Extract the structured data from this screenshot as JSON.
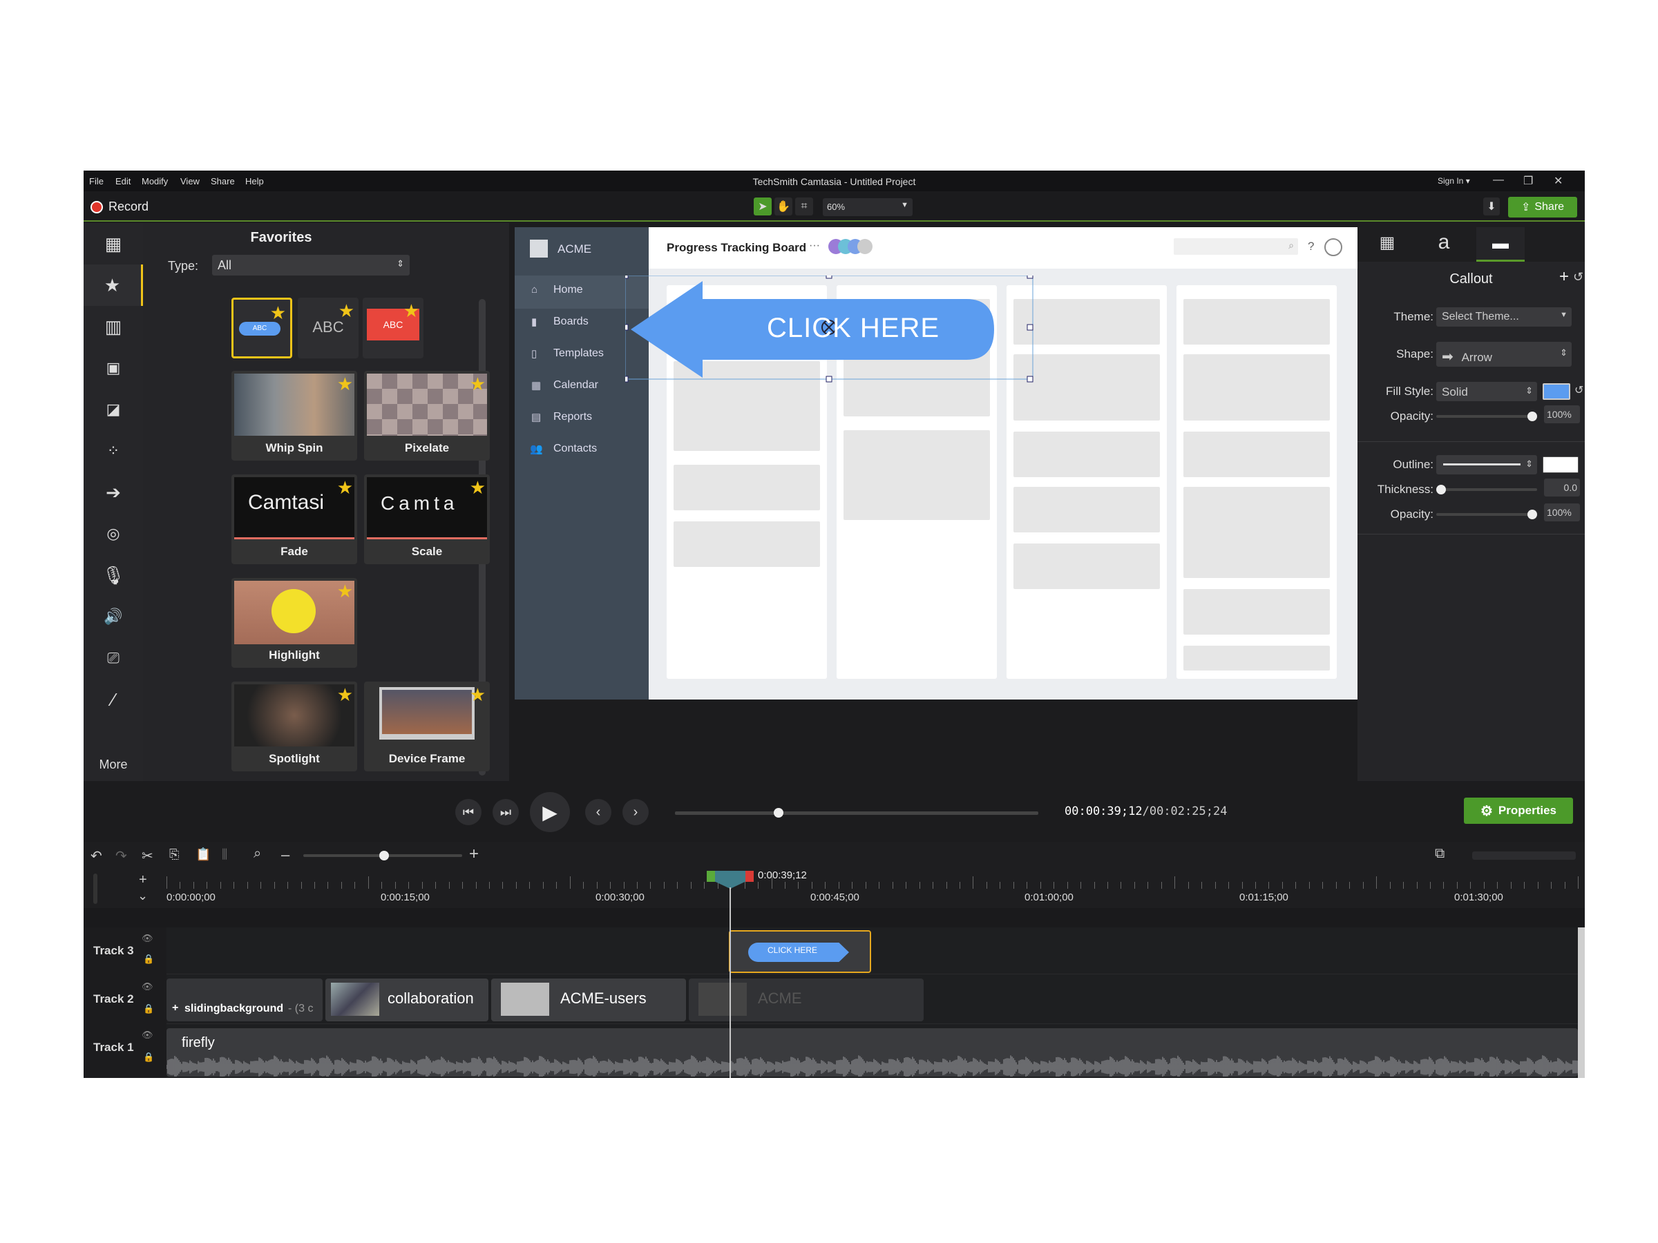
{
  "window": {
    "title": "TechSmith Camtasia - Untitled Project",
    "menu": [
      "File",
      "Edit",
      "Modify",
      "View",
      "Share",
      "Help"
    ],
    "sign_in": "Sign In ▾"
  },
  "toolbar": {
    "record_label": "Record",
    "zoom": "60%",
    "share_label": "Share"
  },
  "library": {
    "title": "Favorites",
    "type_label": "Type:",
    "type_value": "All",
    "more_label": "More",
    "callouts": [
      "ABC",
      "ABC",
      "ABC"
    ],
    "items": [
      {
        "label": "Whip Spin"
      },
      {
        "label": "Pixelate"
      },
      {
        "label": "Fade",
        "thumb_text": "Camtasi"
      },
      {
        "label": "Scale",
        "thumb_text": "Camta"
      },
      {
        "label": "Highlight"
      },
      {
        "label": "Spotlight"
      },
      {
        "label": "Device Frame"
      }
    ]
  },
  "canvas": {
    "app_name": "ACME",
    "board_title": "Progress Tracking Board",
    "board_more": "···",
    "nav": [
      "Home",
      "Boards",
      "Templates",
      "Calendar",
      "Reports",
      "Contacts"
    ],
    "callout_text": "CLICK HERE",
    "help": "?"
  },
  "properties": {
    "title": "Callout",
    "theme_label": "Theme:",
    "theme_value": "Select Theme...",
    "shape_label": "Shape:",
    "shape_value": "Arrow",
    "fill_label": "Fill Style:",
    "fill_value": "Solid",
    "opacity_label": "Opacity:",
    "opacity_value": "100%",
    "outline_label": "Outline:",
    "thickness_label": "Thickness:",
    "thickness_value": "0.0",
    "opacity2_label": "Opacity:",
    "opacity2_value": "100%",
    "button": "Properties",
    "fill_color": "#5b9cf0",
    "outline_color": "#ffffff",
    "opacity_level": 1.0,
    "opacity2_level": 1.0,
    "thickness_level": 0.0
  },
  "playback": {
    "time_current": "00:00:39;12",
    "time_total": "00:02:25;24",
    "separator": "/",
    "progress": 0.28
  },
  "timeline": {
    "playhead_time": "0:00:39;12",
    "ruler": [
      "0:00:00;00",
      "0:00:15;00",
      "0:00:30;00",
      "0:00:45;00",
      "0:01:00;00",
      "0:01:15;00",
      "0:01:30;00"
    ],
    "tracks": [
      {
        "label": "Track 3"
      },
      {
        "label": "Track 2"
      },
      {
        "label": "Track 1"
      }
    ],
    "clips": {
      "callout": "CLICK HERE",
      "group": "slidingbackground",
      "group_suffix": "- (3 c",
      "collab": "collaboration",
      "acme_users": "ACME-users",
      "acme": "ACME",
      "audio": "firefly"
    }
  },
  "colors": {
    "accent_green": "#5a9a2a",
    "callout_blue": "#5b9cf0",
    "record_red": "#e0352b"
  }
}
